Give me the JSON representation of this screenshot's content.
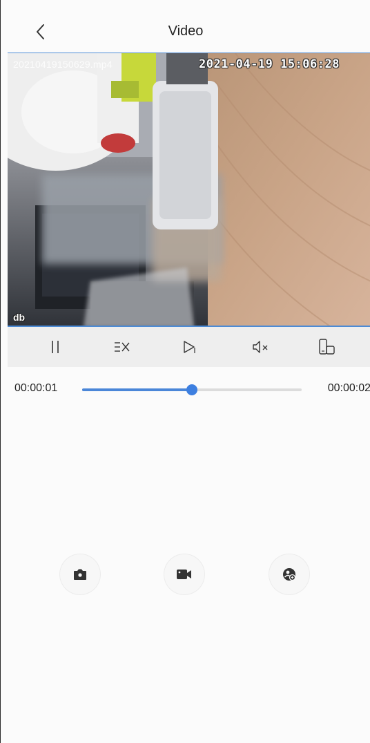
{
  "header": {
    "title": "Video",
    "back_icon": "chevron-left-icon"
  },
  "video": {
    "filename": "20210419150629.mp4",
    "timestamp": "2021-04-19 15:06:28",
    "badge": "db"
  },
  "controls": [
    {
      "icon": "pause-icon"
    },
    {
      "icon": "speed-icon"
    },
    {
      "icon": "next-frame-icon"
    },
    {
      "icon": "mute-icon"
    },
    {
      "icon": "rotate-screen-icon"
    }
  ],
  "playback": {
    "current_time": "00:00:01",
    "total_time": "00:00:02",
    "progress": 0.5
  },
  "actions": [
    {
      "icon": "camera-icon"
    },
    {
      "icon": "video-record-icon"
    },
    {
      "icon": "share-icon"
    }
  ],
  "colors": {
    "accent": "#3d7fe0",
    "track": "#dcdcdc",
    "controls_bg": "#eeeeee"
  }
}
